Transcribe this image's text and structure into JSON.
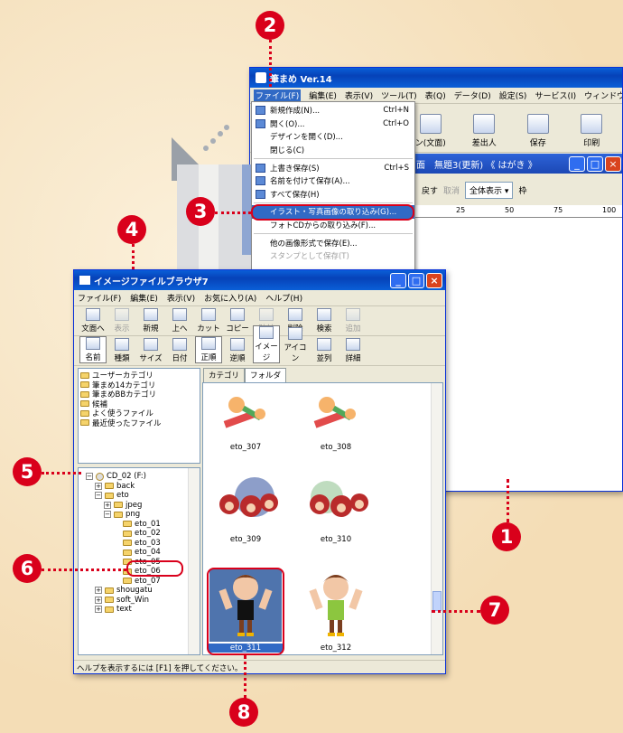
{
  "callouts": [
    "1",
    "2",
    "3",
    "4",
    "5",
    "6",
    "7",
    "8"
  ],
  "app": {
    "title": "筆まめ Ver.14",
    "menu": [
      "ファイル(F)",
      "編集(E)",
      "表示(V)",
      "ツール(T)",
      "表(Q)",
      "データ(D)",
      "設定(S)",
      "サービス(I)",
      "ウィンドウ(W)"
    ],
    "tools": [
      "ン(文面)",
      "差出人",
      "保存",
      "印刷"
    ],
    "doc_title": "面　無題3(更新) 《 はがき 》",
    "sub_tools": {
      "back": "戻す",
      "cancel": "取消",
      "view_option": "全体表示",
      "frame": "枠"
    },
    "ruler": [
      "25",
      "50",
      "75",
      "100"
    ]
  },
  "file_menu": [
    {
      "label": "新規作成(N)...",
      "shortcut": "Ctrl+N",
      "icon": "new-file-icon"
    },
    {
      "label": "開く(O)...",
      "shortcut": "Ctrl+O",
      "icon": "open-folder-icon"
    },
    {
      "label": "デザインを開く(D)...",
      "shortcut": ""
    },
    {
      "label": "閉じる(C)",
      "shortcut": ""
    },
    {
      "label": "上書き保存(S)",
      "shortcut": "Ctrl+S",
      "icon": "save-icon"
    },
    {
      "label": "名前を付けて保存(A)...",
      "shortcut": "",
      "icon": "save-as-icon"
    },
    {
      "label": "すべて保存(H)",
      "shortcut": "",
      "icon": "save-all-icon"
    },
    {
      "label": "イラスト・写真画像の取り込み(G)...",
      "shortcut": "",
      "highlight": true
    },
    {
      "label": "フォトCDからの取り込み(F)...",
      "shortcut": ""
    },
    {
      "label": "他の画像形式で保存(E)...",
      "shortcut": ""
    },
    {
      "label": "スタンプとして保存(T)",
      "shortcut": "",
      "disabled": true
    }
  ],
  "browser": {
    "title": "イメージファイルブラウザ7",
    "menu": [
      "ファイル(F)",
      "編集(E)",
      "表示(V)",
      "お気に入り(A)",
      "ヘルプ(H)"
    ],
    "tools1": [
      {
        "label": "文面へ"
      },
      {
        "label": "表示",
        "disabled": true
      },
      {
        "label": "新規"
      },
      {
        "label": "上へ"
      },
      {
        "label": "カット"
      },
      {
        "label": "コピー"
      },
      {
        "label": "貼付",
        "disabled": true
      },
      {
        "label": "削除"
      },
      {
        "label": "検索"
      },
      {
        "label": "追加",
        "disabled": true
      }
    ],
    "tools2": [
      {
        "label": "名前",
        "pressed": true
      },
      {
        "label": "種類"
      },
      {
        "label": "サイズ"
      },
      {
        "label": "日付"
      },
      {
        "label": "正順",
        "pressed": true
      },
      {
        "label": "逆順"
      },
      {
        "label": "イメージ",
        "pressed": true
      },
      {
        "label": "アイコン"
      },
      {
        "label": "並列"
      },
      {
        "label": "詳細"
      }
    ],
    "categories": [
      "ユーザーカテゴリ",
      "筆まめ14カテゴリ",
      "筆まめBBカテゴリ",
      "候補",
      "よく使うファイル",
      "最近使ったファイル"
    ],
    "tree": [
      {
        "label": "CD_02 (F:)",
        "level": 0,
        "pm": "−",
        "icon": "cd-drive-icon"
      },
      {
        "label": "back",
        "level": 1,
        "pm": "+"
      },
      {
        "label": "eto",
        "level": 1,
        "pm": "−"
      },
      {
        "label": "jpeg",
        "level": 2,
        "pm": "+"
      },
      {
        "label": "png",
        "level": 2,
        "pm": "−"
      },
      {
        "label": "eto_01",
        "level": 3
      },
      {
        "label": "eto_02",
        "level": 3
      },
      {
        "label": "eto_03",
        "level": 3
      },
      {
        "label": "eto_04",
        "level": 3,
        "selected": true
      },
      {
        "label": "eto_05",
        "level": 3
      },
      {
        "label": "eto_06",
        "level": 3
      },
      {
        "label": "eto_07",
        "level": 3
      },
      {
        "label": "shougatu",
        "level": 1,
        "pm": "+"
      },
      {
        "label": "soft_Win",
        "level": 1,
        "pm": "+"
      },
      {
        "label": "text",
        "level": 1,
        "pm": "+"
      }
    ],
    "tabs": [
      "カテゴリ",
      "フォルダ"
    ],
    "thumbs": [
      "eto_307",
      "eto_308",
      "eto_309",
      "eto_310",
      "eto_311",
      "eto_312"
    ],
    "status": "ヘルプを表示するには [F1] を押してください。"
  },
  "colors": {
    "accent": "#d9001b",
    "xp_title": "#0a5fd8",
    "selection": "#316ac5"
  }
}
